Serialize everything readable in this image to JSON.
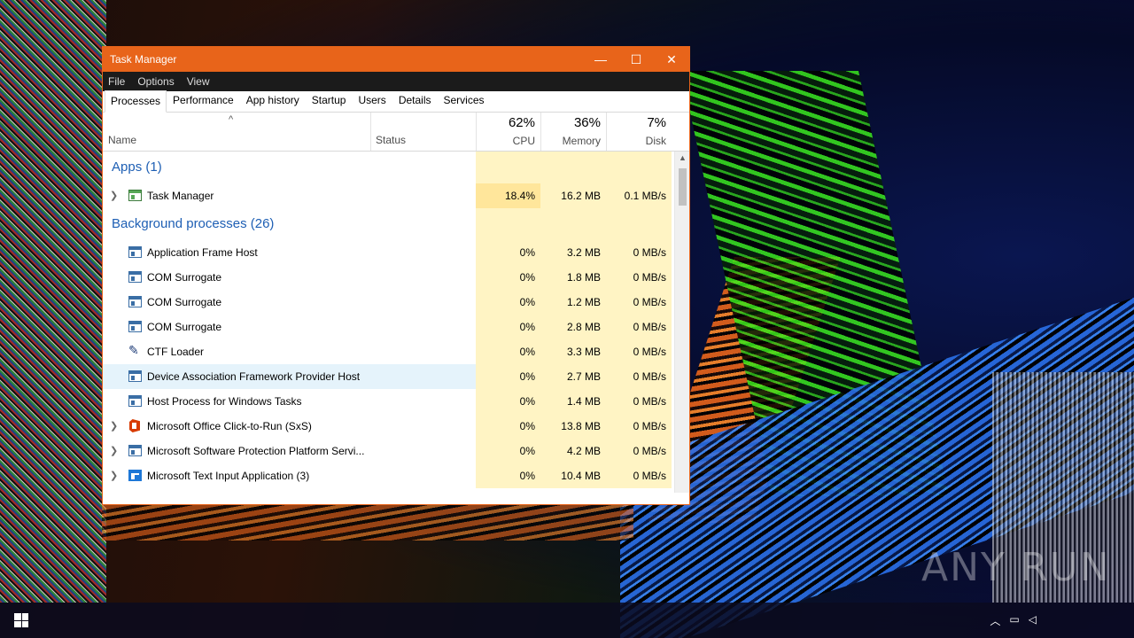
{
  "window": {
    "title": "Task Manager",
    "controls": [
      "—",
      "☐",
      "✕"
    ]
  },
  "menu": [
    "File",
    "Options",
    "View"
  ],
  "tabs": [
    {
      "label": "Processes",
      "active": true
    },
    {
      "label": "Performance"
    },
    {
      "label": "App history"
    },
    {
      "label": "Startup"
    },
    {
      "label": "Users"
    },
    {
      "label": "Details"
    },
    {
      "label": "Services"
    }
  ],
  "header": {
    "sort_indicator": "^",
    "name": "Name",
    "status": "Status",
    "cpu": {
      "pct": "62%",
      "label": "CPU"
    },
    "memory": {
      "pct": "36%",
      "label": "Memory"
    },
    "disk": {
      "pct": "7%",
      "label": "Disk"
    }
  },
  "groups": {
    "apps": "Apps (1)",
    "background": "Background processes (26)"
  },
  "apps": [
    {
      "name": "Task Manager",
      "cpu": "18.4%",
      "memory": "16.2 MB",
      "disk": "0.1 MB/s",
      "icon": "task-manager-icon",
      "expandable": true
    }
  ],
  "processes": [
    {
      "name": "Application Frame Host",
      "cpu": "0%",
      "memory": "3.2 MB",
      "disk": "0 MB/s",
      "icon": "window-icon"
    },
    {
      "name": "COM Surrogate",
      "cpu": "0%",
      "memory": "1.8 MB",
      "disk": "0 MB/s",
      "icon": "window-icon"
    },
    {
      "name": "COM Surrogate",
      "cpu": "0%",
      "memory": "1.2 MB",
      "disk": "0 MB/s",
      "icon": "window-icon"
    },
    {
      "name": "COM Surrogate",
      "cpu": "0%",
      "memory": "2.8 MB",
      "disk": "0 MB/s",
      "icon": "window-icon"
    },
    {
      "name": "CTF Loader",
      "cpu": "0%",
      "memory": "3.3 MB",
      "disk": "0 MB/s",
      "icon": "ctf-loader-icon"
    },
    {
      "name": "Device Association Framework Provider Host",
      "cpu": "0%",
      "memory": "2.7 MB",
      "disk": "0 MB/s",
      "icon": "window-icon",
      "hover": true
    },
    {
      "name": "Host Process for Windows Tasks",
      "cpu": "0%",
      "memory": "1.4 MB",
      "disk": "0 MB/s",
      "icon": "window-icon"
    },
    {
      "name": "Microsoft Office Click-to-Run (SxS)",
      "cpu": "0%",
      "memory": "13.8 MB",
      "disk": "0 MB/s",
      "icon": "office-icon",
      "expandable": true
    },
    {
      "name": "Microsoft Software Protection Platform Servi...",
      "cpu": "0%",
      "memory": "4.2 MB",
      "disk": "0 MB/s",
      "icon": "window-icon",
      "expandable": true
    },
    {
      "name": "Microsoft Text Input Application (3)",
      "cpu": "0%",
      "memory": "10.4 MB",
      "disk": "0 MB/s",
      "icon": "text-input-icon",
      "expandable": true
    }
  ],
  "watermark": "ANY RUN",
  "colors": {
    "group_title": "#1e5fb4",
    "heat_light": "#fff4c4",
    "heat_strong": "#ffe69b",
    "hover_row": "#e5f3fb"
  }
}
